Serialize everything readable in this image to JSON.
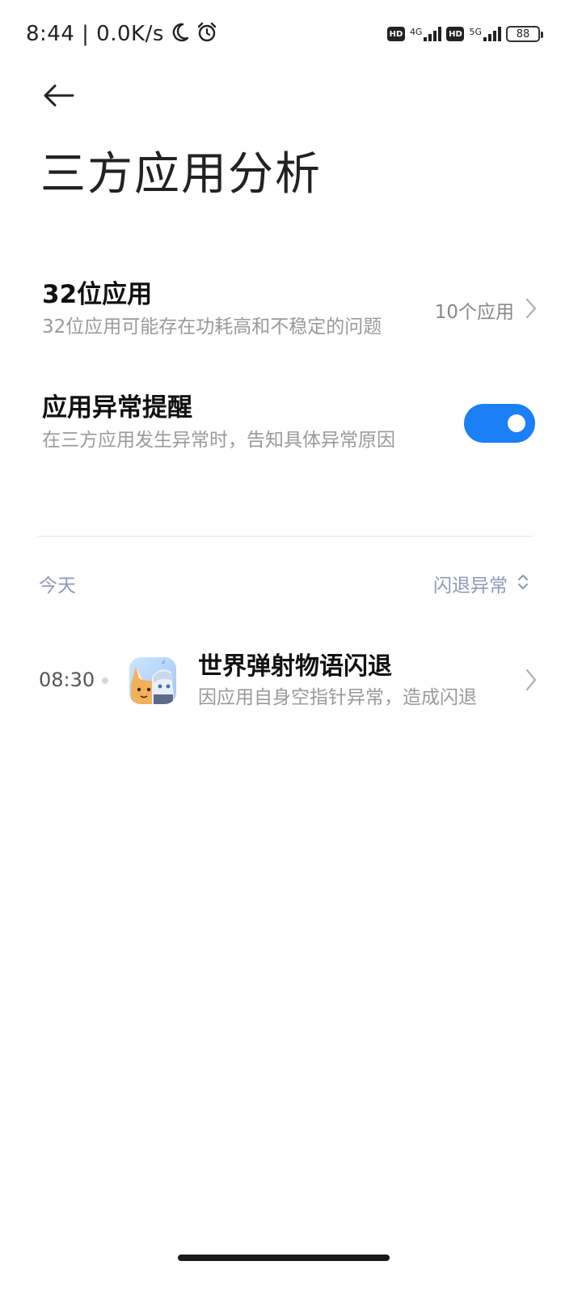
{
  "status_bar": {
    "time_and_speed": "8:44 | 0.0K/s",
    "hd_badge_1": "HD",
    "network_1": "4G",
    "hd_badge_2": "HD",
    "network_2": "5G",
    "battery": "88"
  },
  "header": {
    "back_icon": "arrow-left-icon",
    "title": "三方应用分析"
  },
  "settings": {
    "app32": {
      "title": "32位应用",
      "subtitle": "32位应用可能存在功耗高和不稳定的问题",
      "value": "10个应用"
    },
    "abnormal_reminder": {
      "title": "应用异常提醒",
      "subtitle": "在三方应用发生异常时，告知具体异常原因",
      "enabled": true,
      "toggle_color": "#1b7ff5"
    }
  },
  "events_section": {
    "date_label": "今天",
    "filter_label": "闪退异常",
    "events": [
      {
        "time": "08:30",
        "title": "世界弹射物语闪退",
        "description": "因应用自身空指针异常，造成闪退"
      }
    ]
  }
}
